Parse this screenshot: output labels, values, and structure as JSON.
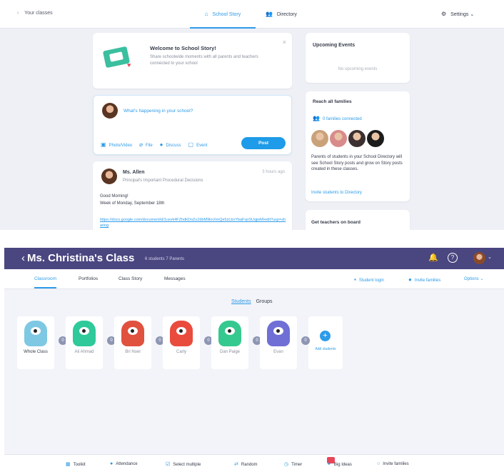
{
  "school_story": {
    "nav": {
      "back_label": "Your classes",
      "tab_school_story": "School Story",
      "tab_directory": "Directory",
      "settings_label": "Settings"
    },
    "welcome": {
      "title": "Welcome to School Story!",
      "text": "Share schoolwide moments with all parents and teachers connected to your school"
    },
    "composer": {
      "placeholder": "What's happening in your school?",
      "tools": [
        "Photo/Video",
        "File",
        "Discuss",
        "Event"
      ],
      "post_label": "Post"
    },
    "post": {
      "author": "Ms. Allen",
      "role": "Principal's Important Procedural Decisions",
      "time": "3 hours ago",
      "body_line1": "Good Morning!",
      "body_line2": "Week of Monday, September 18th",
      "link": "https://docs.google.com/document/d/1uxvk4FZhdkDoZu2dbM9knXmQe5zLbvYbaFvpSUqjwM/edit?usp=sharing"
    },
    "events": {
      "title": "Upcoming Events",
      "empty": "No upcoming events"
    },
    "families": {
      "title": "Reach all families",
      "connected": "0 families connected",
      "face_colors": [
        "#c9a27a",
        "#d98b8b",
        "#3d3030",
        "#1c1c1c"
      ],
      "description": "Parents of students in your School Directory will see School Story posts and grow on Story posts created in these classes.",
      "invite_label": "Invite students to Directory"
    },
    "teachers": {
      "title": "Get teachers on board"
    }
  },
  "classroom": {
    "header": {
      "title": "Ms. Christina's Class",
      "meta": "6 students   7 Parents"
    },
    "tabs": [
      "Classroom",
      "Portfolios",
      "Class Story",
      "Messages"
    ],
    "right_links": [
      "Student login",
      "Invite families",
      "Options"
    ],
    "view_switch": {
      "students": "Students",
      "groups": "Groups"
    },
    "students": [
      {
        "name": "Whole Class",
        "color": "#7ec8e3",
        "points": "0"
      },
      {
        "name": "Ali Ahmad",
        "color": "#2fc99a",
        "points": "0"
      },
      {
        "name": "Bri Noel",
        "color": "#e0513e",
        "points": "0"
      },
      {
        "name": "Carly",
        "color": "#e94b3c",
        "points": "0"
      },
      {
        "name": "Dan Paige",
        "color": "#36c98f",
        "points": "0"
      },
      {
        "name": "Evan",
        "color": "#6f6fd6",
        "points": "0"
      }
    ],
    "add_students_label": "Add students",
    "toolbar": [
      "Toolkit",
      "Attendance",
      "Select multiple",
      "Random",
      "Timer",
      "Big Ideas",
      "Invite families"
    ]
  }
}
